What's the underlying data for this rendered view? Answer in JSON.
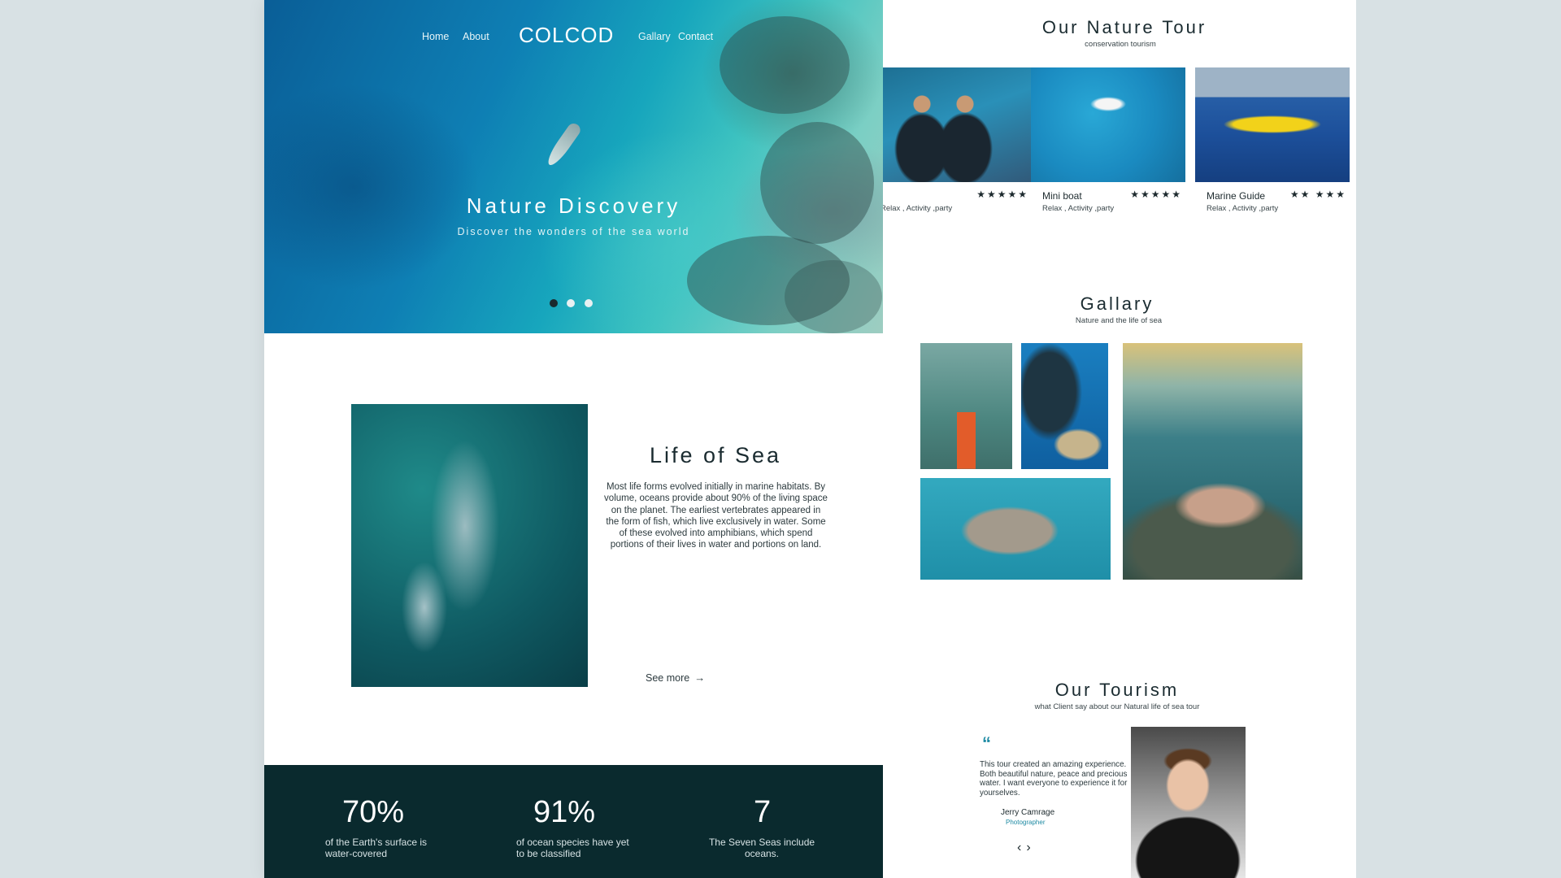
{
  "colors": {
    "accent": "#1d8aa3",
    "dark_band": "#0a2a2e",
    "text_dark": "#1a2b30",
    "backdrop": "#d8e1e4"
  },
  "nav": {
    "logo": "COLCOD",
    "items": [
      "Home",
      "About",
      "Gallary",
      "Contact"
    ]
  },
  "hero": {
    "title": "Nature Discovery",
    "subtitle": "Discover the wonders of the sea world",
    "slide_count": 3,
    "active_slide": 1
  },
  "life": {
    "title": "Life of Sea",
    "body": "Most life forms evolved initially in marine habitats. By volume, oceans provide about 90% of the living space on the planet. The earliest vertebrates appeared in the form of fish, which live exclusively in water. Some of these evolved into amphibians, which spend portions of their lives in water and portions on land.",
    "see_more": "See more"
  },
  "stats": [
    {
      "value": "70%",
      "label": "of the Earth's surface is water-covered"
    },
    {
      "value": "91%",
      "label": "of ocean species have yet to be classified"
    },
    {
      "value": "7",
      "label": "The Seven Seas include oceans."
    }
  ],
  "tour": {
    "title": "Our Nature Tour",
    "subtitle": "conservation tourism",
    "cards": [
      {
        "name": "",
        "rating": 5,
        "stars": "★★★★★",
        "tags": "Relax , Activity ,party",
        "icon": "divers-image"
      },
      {
        "name": "Mini boat",
        "rating": 5,
        "stars": "★★★★★",
        "tags": "Relax , Activity ,party",
        "icon": "boat-image"
      },
      {
        "name": "Marine Guide",
        "rating": 5,
        "stars": "★★ ★★★",
        "tags": "Relax , Activity ,party",
        "icon": "guide-boat-image"
      }
    ]
  },
  "gallery": {
    "title": "Gallary",
    "subtitle": "Nature and the life of sea"
  },
  "testimonial": {
    "title": "Our Tourism",
    "subtitle": "what Client say about our Natural life of sea tour",
    "quote_mark": "“",
    "quote": "This tour created an amazing experience. Both beautiful nature, peace and precious water. I want everyone to experience it for yourselves.",
    "author": "Jerry Camrage",
    "role": "Photographer",
    "prev_icon": "chevron-left-icon",
    "next_icon": "chevron-right-icon"
  }
}
